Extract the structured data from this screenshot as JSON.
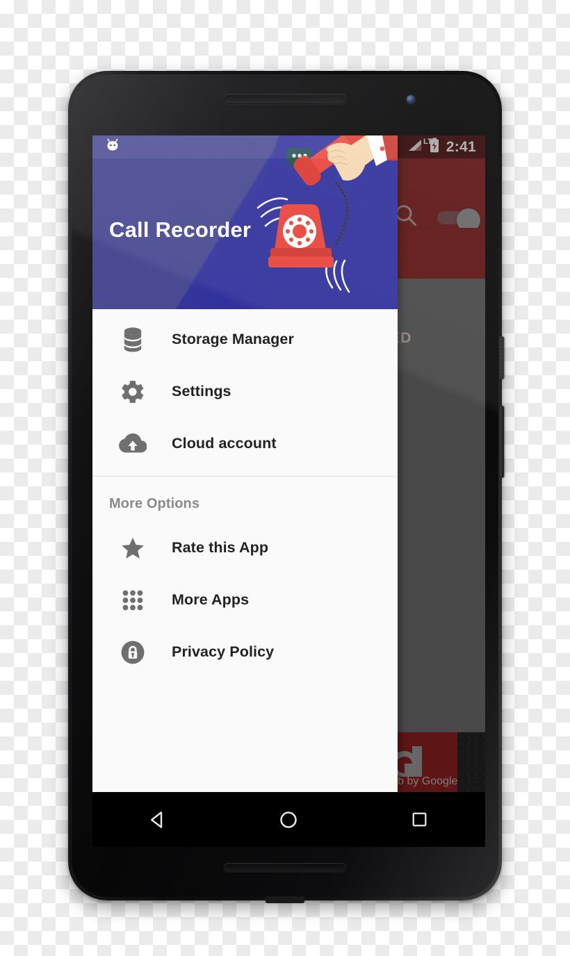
{
  "device": {
    "name": "android-smartphone",
    "earpiece": "earpiece-speaker",
    "camera": "front-camera"
  },
  "status_bar": {
    "time": "2:41",
    "network_label": "LTE",
    "signal_icon": "signal-bars-icon",
    "battery_icon": "battery-charging-icon",
    "notification_icon": "android-marshmallow-icon"
  },
  "drawer": {
    "title": "Call Recorder",
    "header_illustration": "rotary-phone-hand-illustration",
    "primary_items": [
      {
        "label": "Storage Manager",
        "icon": "database-icon"
      },
      {
        "label": "Settings",
        "icon": "gear-icon"
      },
      {
        "label": "Cloud account",
        "icon": "cloud-upload-icon"
      }
    ],
    "section_label": "More Options",
    "more_items": [
      {
        "label": "Rate this App",
        "icon": "star-icon"
      },
      {
        "label": "More Apps",
        "icon": "apps-grid-icon"
      },
      {
        "label": "Privacy Policy",
        "icon": "lock-circle-icon"
      }
    ]
  },
  "background_app": {
    "search_icon": "search-icon",
    "record_toggle": "toggle-switch-on",
    "tab_label": "ED",
    "theme_color": "#8c2020",
    "status_bar_color": "#4d0f0f"
  },
  "ad": {
    "logo": "admob-logo-icon",
    "text": "dMob by Google"
  },
  "nav_bar": {
    "back": "back-triangle-icon",
    "home": "home-circle-icon",
    "recents": "recents-square-icon"
  },
  "colors": {
    "drawer_header_start": "#4a4a92",
    "drawer_header_end": "#2f2fa0",
    "drawer_bg": "#fafafa",
    "accent_red": "#e23c34",
    "icon_gray": "#6f6f6f"
  }
}
